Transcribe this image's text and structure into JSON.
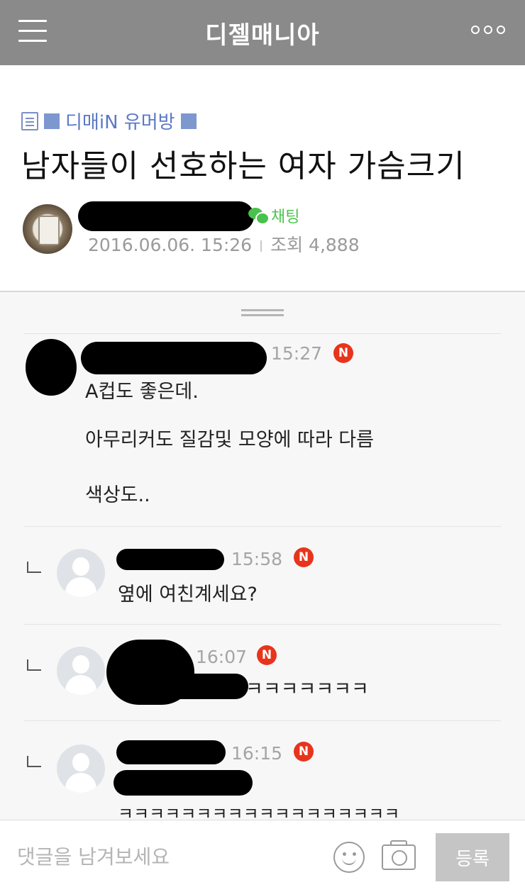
{
  "header": {
    "title": "디젤매니아",
    "menu_icon": "hamburger-menu-icon",
    "more_icon": "more-dots-icon"
  },
  "post": {
    "board_name": "디매iN 유머방",
    "title": "남자들이 선호하는 여자 가슴크기",
    "chat_label": "채팅",
    "date": "2016.06.06. 15:26",
    "views": "조회 4,888"
  },
  "comments": [
    {
      "time": "15:27",
      "badge": "N",
      "lines": [
        "A컵도 좋은데.",
        "아무리커도 질감및 모양에 따라 다름",
        "색상도.."
      ]
    },
    {
      "is_reply": true,
      "time": "15:58",
      "badge": "N",
      "lines": [
        "옆에 여친계세요?"
      ]
    },
    {
      "is_reply": true,
      "time": "16:07",
      "badge": "N",
      "lines": [
        "ㅋㅋㅋㅋㅋㅋㅋ"
      ]
    },
    {
      "is_reply": true,
      "time": "16:15",
      "badge": "N",
      "lines": [
        "ㅋㅋㅋㅋㅋㅋㅋㅋㅋㅋㅋㅋㅋㅋㅋㅋㅋㅋ"
      ]
    }
  ],
  "composer": {
    "placeholder": "댓글을 남겨보세요",
    "submit_label": "등록"
  },
  "colors": {
    "header_bg": "#8a8a8a",
    "board_blue": "#5b79c4",
    "chat_green": "#4cc54c",
    "new_badge_red": "#e8341c"
  }
}
